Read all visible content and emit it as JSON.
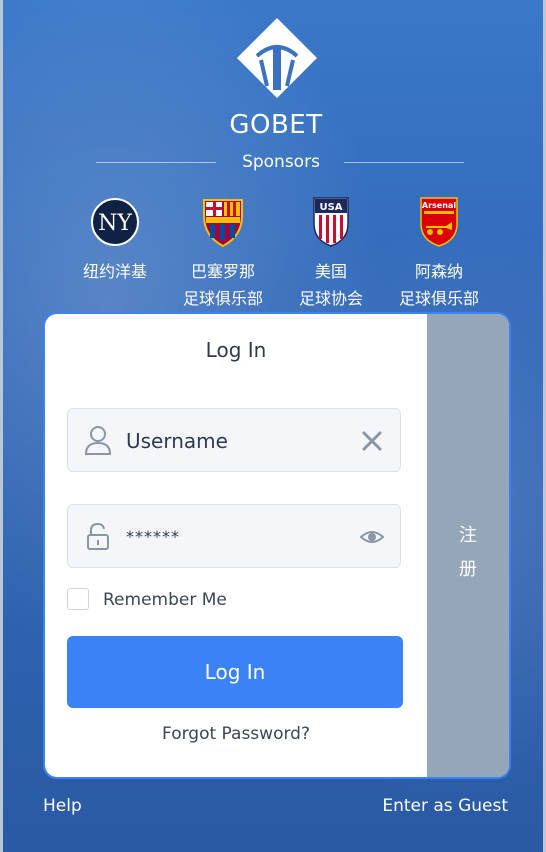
{
  "brand": {
    "name": "GOBET",
    "logo_icon": "gobet-diamond-logo-icon"
  },
  "sponsors_heading": "Sponsors",
  "sponsors": [
    {
      "lines": [
        "纽约洋基"
      ],
      "icon": "yankees-logo-icon"
    },
    {
      "lines": [
        "巴塞罗那",
        "足球俱乐部"
      ],
      "icon": "fc-barcelona-crest-icon"
    },
    {
      "lines": [
        "美国",
        "足球协会"
      ],
      "icon": "usa-soccer-crest-icon"
    },
    {
      "lines": [
        "阿森纳",
        "足球俱乐部"
      ],
      "icon": "arsenal-crest-icon",
      "crest_text": "Arsenal"
    }
  ],
  "login": {
    "title": "Log In",
    "username_value": "Username",
    "password_value": "******",
    "remember_label": "Remember Me",
    "button_label": "Log In",
    "forgot_label": "Forgot Password?"
  },
  "side_tab": {
    "label_line1": "注",
    "label_line2": "册"
  },
  "footer": {
    "help": "Help",
    "guest": "Enter as Guest"
  },
  "colors": {
    "accent": "#3b82f6",
    "side_tab": "#95a6b8",
    "background": "#3268b8"
  }
}
